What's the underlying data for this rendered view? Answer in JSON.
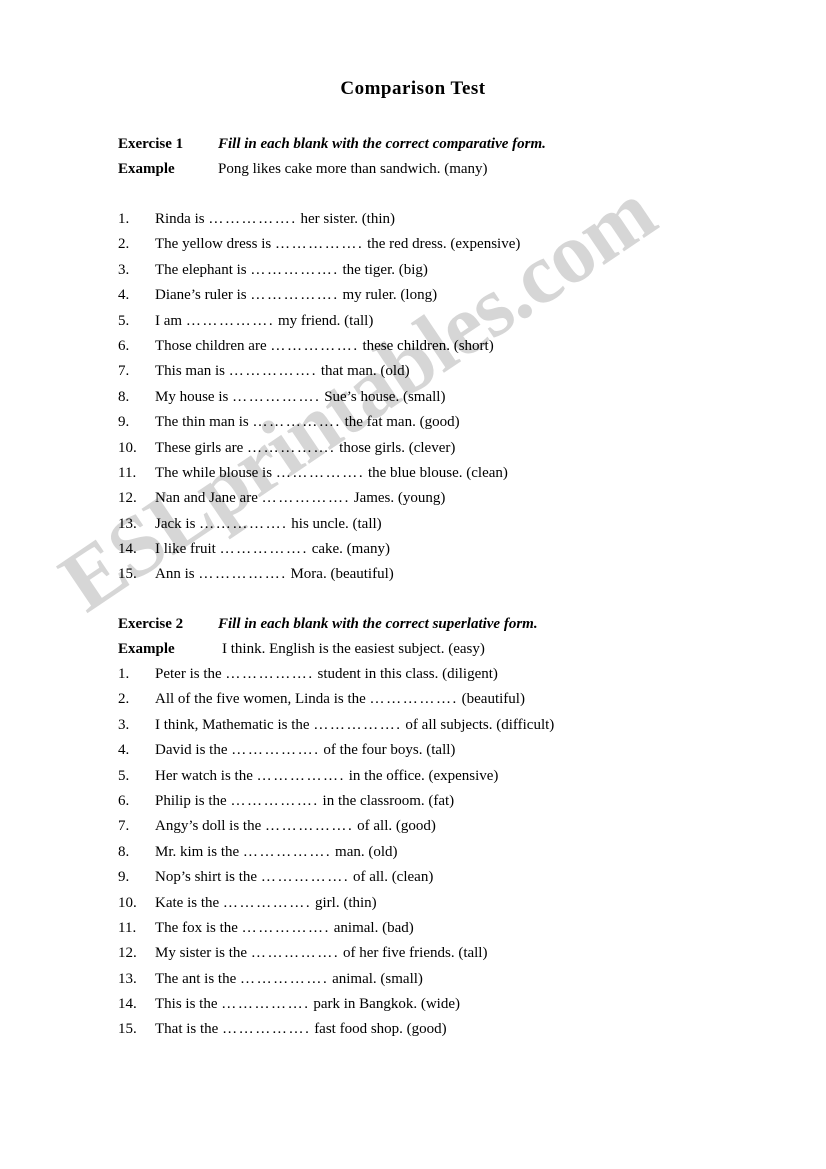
{
  "document": {
    "title": "Comparison Test",
    "watermark": "ESLprintables.com",
    "watermark_color": "#d6d6d6",
    "blank": "……………."
  },
  "exercise1": {
    "label": "Exercise 1",
    "instruction": "Fill in each blank with the correct comparative form.",
    "example_label": "Example",
    "example_text": "Pong likes cake more than sandwich.  (many)",
    "items": [
      {
        "num": "1.",
        "before": "Rinda is ",
        "after": " her sister.  (thin)"
      },
      {
        "num": "2.",
        "before": "The yellow dress is ",
        "after": " the red dress.  (expensive)"
      },
      {
        "num": "3.",
        "before": "The elephant is ",
        "after": " the tiger.  (big)"
      },
      {
        "num": "4.",
        "before": "Diane’s ruler is ",
        "after": " my ruler.  (long)"
      },
      {
        "num": "5.",
        "before": "I am ",
        "after": " my friend.  (tall)"
      },
      {
        "num": "6.",
        "before": "Those children are ",
        "after": " these children.  (short)"
      },
      {
        "num": "7.",
        "before": "This man is ",
        "after": " that man.  (old)"
      },
      {
        "num": "8.",
        "before": "My house is ",
        "after": " Sue’s house.  (small)"
      },
      {
        "num": "9.",
        "before": "The thin man is ",
        "after": " the fat man.  (good)"
      },
      {
        "num": "10.",
        "before": "These girls are ",
        "after": " those girls.  (clever)"
      },
      {
        "num": "11.",
        "before": "The while blouse is ",
        "after": " the blue blouse.  (clean)"
      },
      {
        "num": "12.",
        "before": "Nan and Jane are ",
        "after": " James.  (young)"
      },
      {
        "num": "13.",
        "before": "Jack is ",
        "after": " his uncle.  (tall)"
      },
      {
        "num": "14.",
        "before": "I like fruit ",
        "after": " cake.  (many)"
      },
      {
        "num": "15.",
        "before": "Ann is ",
        "after": " Mora.  (beautiful)"
      }
    ]
  },
  "exercise2": {
    "label": "Exercise 2",
    "instruction": "Fill in each blank with the correct superlative form.",
    "example_label": "Example",
    "example_text": "I think. English is the easiest subject.  (easy)",
    "items": [
      {
        "num": "1.",
        "before": "Peter is the ",
        "after": " student in this class.  (diligent)"
      },
      {
        "num": "2.",
        "before": "All of the five women, Linda is the ",
        "after": " (beautiful)"
      },
      {
        "num": "3.",
        "before": "I think, Mathematic is the ",
        "after": " of all subjects.  (difficult)"
      },
      {
        "num": "4.",
        "before": "David is the ",
        "after": " of the four boys.  (tall)"
      },
      {
        "num": "5.",
        "before": "Her watch is the ",
        "after": " in the office.  (expensive)"
      },
      {
        "num": "6.",
        "before": "Philip is the ",
        "after": " in the classroom.  (fat)"
      },
      {
        "num": "7.",
        "before": "Angy’s doll is the ",
        "after": " of all.  (good)"
      },
      {
        "num": "8.",
        "before": "Mr. kim is the ",
        "after": " man. (old)"
      },
      {
        "num": "9.",
        "before": "Nop’s shirt is the ",
        "after": " of all. (clean)"
      },
      {
        "num": "10.",
        "before": "Kate is the ",
        "after": " girl.  (thin)"
      },
      {
        "num": "11.",
        "before": "The fox is the ",
        "after": " animal.  (bad)"
      },
      {
        "num": "12.",
        "before": "My sister is the ",
        "after": " of her five friends.  (tall)"
      },
      {
        "num": "13.",
        "before": "The ant is the ",
        "after": " animal.  (small)"
      },
      {
        "num": "14.",
        "before": "This is the ",
        "after": " park in Bangkok.  (wide)"
      },
      {
        "num": "15.",
        "before": "That is the ",
        "after": " fast food shop.  (good)"
      }
    ]
  }
}
